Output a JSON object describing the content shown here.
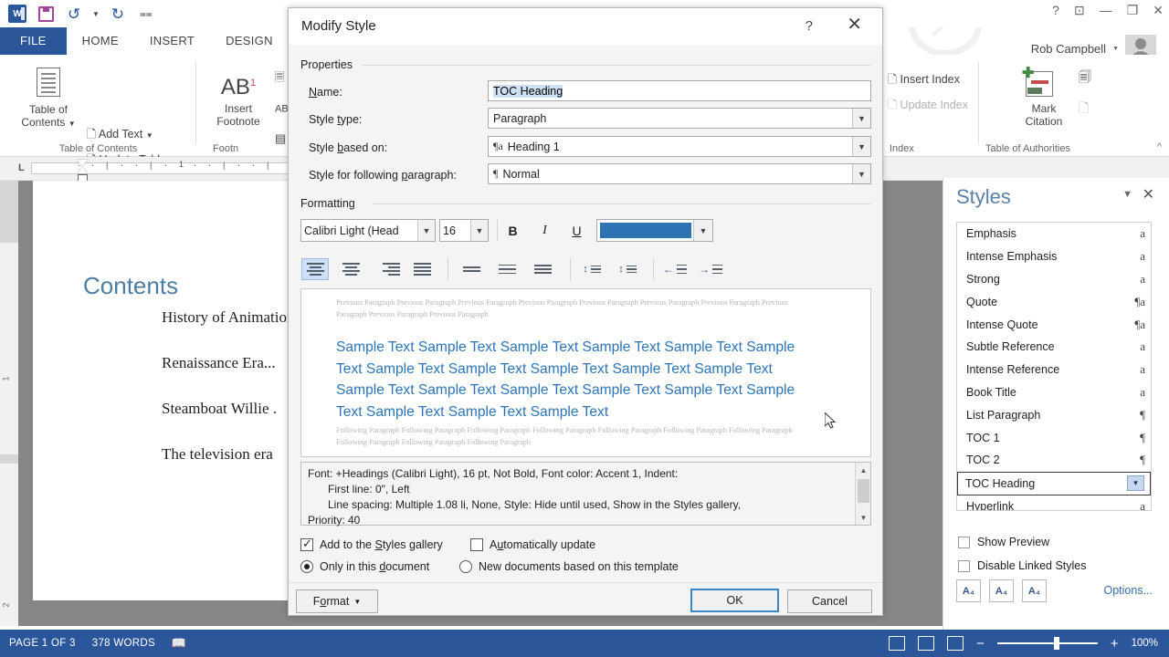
{
  "app": {
    "quick_access": [
      "word-logo",
      "save-icon",
      "undo-icon",
      "redo-icon",
      "customize-qat-icon"
    ],
    "window_buttons": [
      "help-icon",
      "ribbon-display-icon",
      "minimize-icon",
      "restore-icon",
      "close-icon"
    ],
    "user_name": "Rob Campbell",
    "tabs": [
      "FILE",
      "HOME",
      "INSERT",
      "DESIGN"
    ]
  },
  "ribbon": {
    "groups": [
      {
        "label": "Table of Contents",
        "big_button": "Table of\nContents",
        "big_button_line1": "Table of",
        "big_button_line2": "Contents",
        "items": [
          "Add Text",
          "Update Table"
        ]
      },
      {
        "label": "Footnotes",
        "label_clipped": "Footn",
        "big_button_line1": "Insert",
        "big_button_line2": "Footnote",
        "ab_label": "AB",
        "ab_sup": "1"
      },
      {
        "label": "Index",
        "items": [
          "Insert Index",
          "Update Index"
        ]
      },
      {
        "label": "Table of Authorities",
        "big_button_line1": "Mark",
        "big_button_line2": "Citation"
      }
    ]
  },
  "document": {
    "heading": "Contents",
    "toc_entries": [
      "History of Animation",
      "Renaissance Era...",
      "Steamboat Willie .",
      "The television era"
    ],
    "ruler_number": "1"
  },
  "status_bar": {
    "page": "PAGE 1 OF 3",
    "words": "378 WORDS",
    "proofing_icon": "proofing-errors-icon",
    "view_icons": [
      "read-mode-icon",
      "print-layout-icon",
      "web-layout-icon"
    ],
    "zoom_out": "−",
    "zoom_in": "+",
    "zoom_level": "100%"
  },
  "styles_pane": {
    "title": "Styles",
    "caret_icon": "chevron-down-icon",
    "close_icon": "close-icon",
    "items": [
      {
        "name": "Emphasis",
        "mark": "a"
      },
      {
        "name": "Intense Emphasis",
        "mark": "a"
      },
      {
        "name": "Strong",
        "mark": "a"
      },
      {
        "name": "Quote",
        "mark": "¶a"
      },
      {
        "name": "Intense Quote",
        "mark": "¶a"
      },
      {
        "name": "Subtle Reference",
        "mark": "a"
      },
      {
        "name": "Intense Reference",
        "mark": "a"
      },
      {
        "name": "Book Title",
        "mark": "a"
      },
      {
        "name": "List Paragraph",
        "mark": "¶"
      },
      {
        "name": "TOC 1",
        "mark": "¶"
      },
      {
        "name": "TOC 2",
        "mark": "¶"
      },
      {
        "name": "TOC Heading",
        "mark": "▼",
        "selected": true
      },
      {
        "name": "Hyperlink",
        "mark": "a"
      }
    ],
    "show_preview": "Show Preview",
    "disable_linked": "Disable Linked Styles",
    "buttons": [
      "new-style-icon",
      "style-inspector-icon",
      "manage-styles-icon"
    ],
    "options": "Options..."
  },
  "dialog": {
    "title": "Modify Style",
    "help_icon": "?",
    "close_icon": "✕",
    "properties_label": "Properties",
    "formatting_label": "Formatting",
    "fields": {
      "name_label": "Name:",
      "name_value": "TOC Heading",
      "style_type_label": "Style type:",
      "style_type_value": "Paragraph",
      "style_based_on_label": "Style based on:",
      "style_based_on_value": "Heading 1",
      "style_based_on_mark": "¶a",
      "style_following_label": "Style for following paragraph:",
      "style_following_value": "Normal",
      "style_following_mark": "¶"
    },
    "formatting": {
      "font_name": "Calibri Light (Head",
      "font_size": "16",
      "bold": "B",
      "italic": "I",
      "underline": "U",
      "font_color": "#2e74b5",
      "align_icons": [
        "align-left-icon",
        "align-center-icon",
        "align-right-icon",
        "align-justify-icon"
      ],
      "spacing_icons": [
        "line-spacing-single-icon",
        "line-spacing-1.5-icon",
        "line-spacing-double-icon"
      ],
      "para_icons": [
        "decrease-spacing-icon",
        "increase-spacing-icon"
      ],
      "indent_icons": [
        "decrease-indent-icon",
        "increase-indent-icon"
      ]
    },
    "preview": {
      "previous_paragraph": "Previous Paragraph Previous Paragraph Previous Paragraph Previous Paragraph Previous Paragraph Previous Paragraph Previous Paragraph Previous Paragraph Previous Paragraph Previous Paragraph",
      "sample_text": "Sample Text Sample Text Sample Text Sample Text Sample Text Sample Text Sample Text Sample Text Sample Text Sample Text Sample Text Sample Text Sample Text Sample Text Sample Text Sample Text Sample Text Sample Text Sample Text Sample Text",
      "following_paragraph": "Following Paragraph Following Paragraph Following Paragraph Following Paragraph Following Paragraph Following Paragraph Following Paragraph Following Paragraph Following Paragraph Following Paragraph"
    },
    "description": "Font: +Headings (Calibri Light), 16 pt, Not Bold, Font color: Accent 1, Indent:\n    First line:  0\", Left\n    Line spacing:  Multiple 1.08 li, None, Style: Hide until used, Show in the Styles gallery,\nPriority: 40",
    "description_line1": "Font: +Headings (Calibri Light), 16 pt, Not Bold, Font color: Accent 1, Indent:",
    "description_line2": "First line:  0\", Left",
    "description_line3": "Line spacing:  Multiple 1.08 li, None, Style: Hide until used, Show in the Styles gallery,",
    "description_line4": "Priority: 40",
    "options": {
      "add_to_gallery": "Add to the Styles gallery",
      "add_to_gallery_checked": true,
      "auto_update": "Automatically update",
      "auto_update_checked": false,
      "only_this_doc": "Only in this document",
      "only_this_doc_selected": true,
      "new_docs_template": "New documents based on this template"
    },
    "buttons": {
      "format": "Format",
      "ok": "OK",
      "cancel": "Cancel"
    }
  }
}
